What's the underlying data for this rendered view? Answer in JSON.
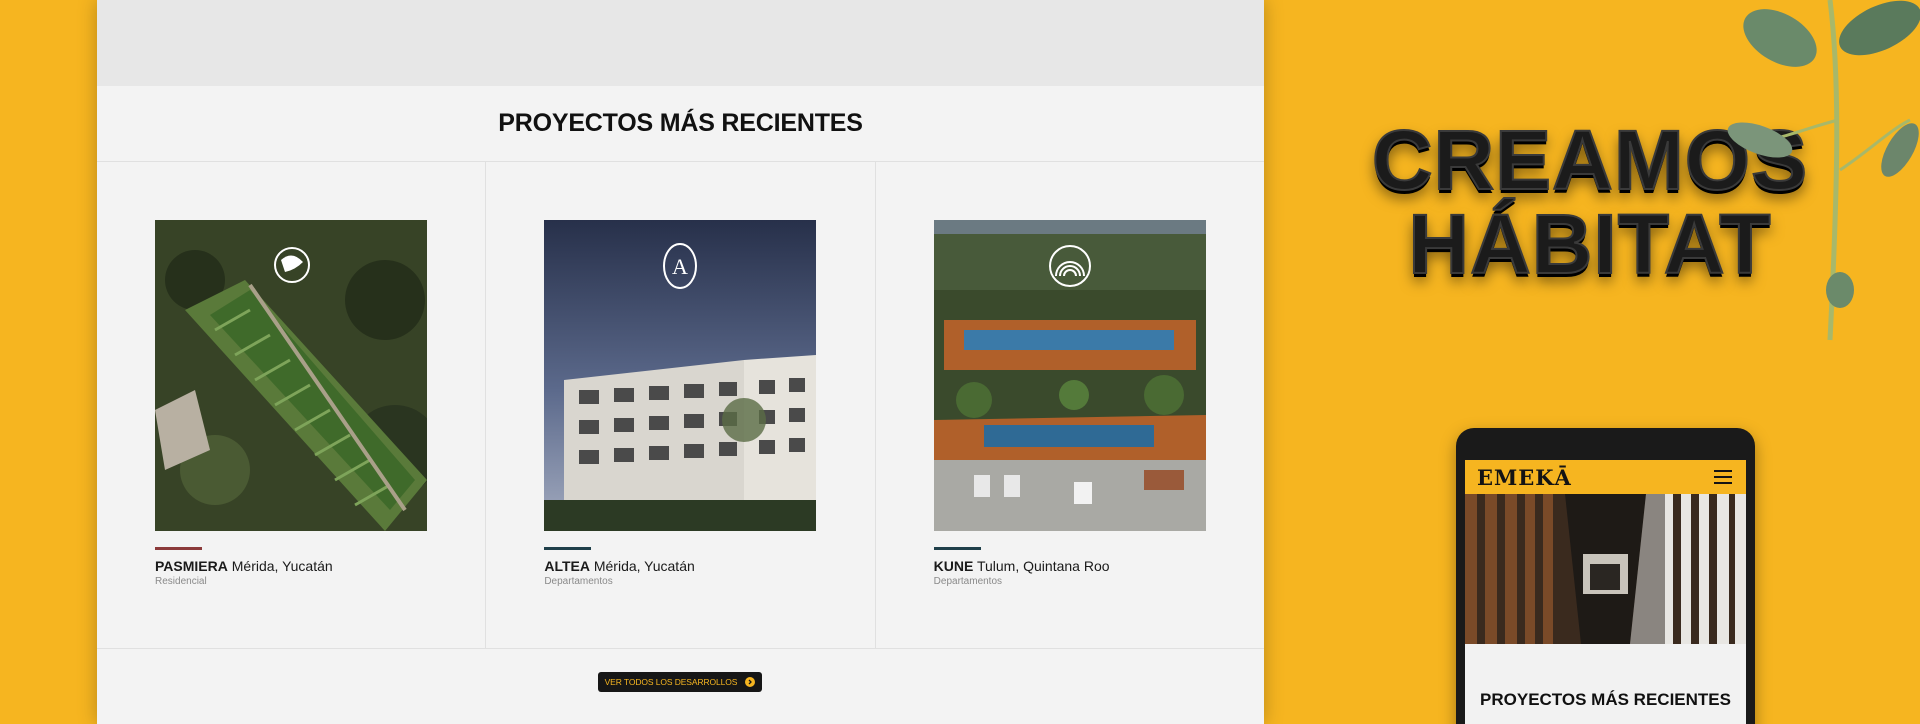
{
  "desktop": {
    "section_title": "PROYECTOS MÁS RECIENTES",
    "projects": [
      {
        "name": "PASMIERA",
        "location": "Mérida, Yucatán",
        "type": "Residencial",
        "accent": "#8b3a3a",
        "logo_icon": "globe-emblem-icon"
      },
      {
        "name": "ALTEA",
        "location": "Mérida, Yucatán",
        "type": "Departamentos",
        "accent": "#1f3f4a",
        "logo_icon": "letter-a-emblem-icon"
      },
      {
        "name": "KUNE",
        "location": "Tulum, Quintana Roo",
        "type": "Departamentos",
        "accent": "#1f3f4a",
        "logo_icon": "arches-emblem-icon"
      }
    ],
    "cta_label": "VER TODOS LOS DESARROLLOS",
    "cta_icon": "arrow-right-circle-icon"
  },
  "headline": {
    "line1": "CREAMOS",
    "line2": "HÁBITAT"
  },
  "phone": {
    "logo": "EMEKĀ",
    "menu_icon": "hamburger-menu-icon",
    "section_title": "PROYECTOS MÁS RECIENTES"
  },
  "colors": {
    "brand_yellow": "#f6b520",
    "dark": "#161616",
    "panel": "#f3f3f3"
  }
}
